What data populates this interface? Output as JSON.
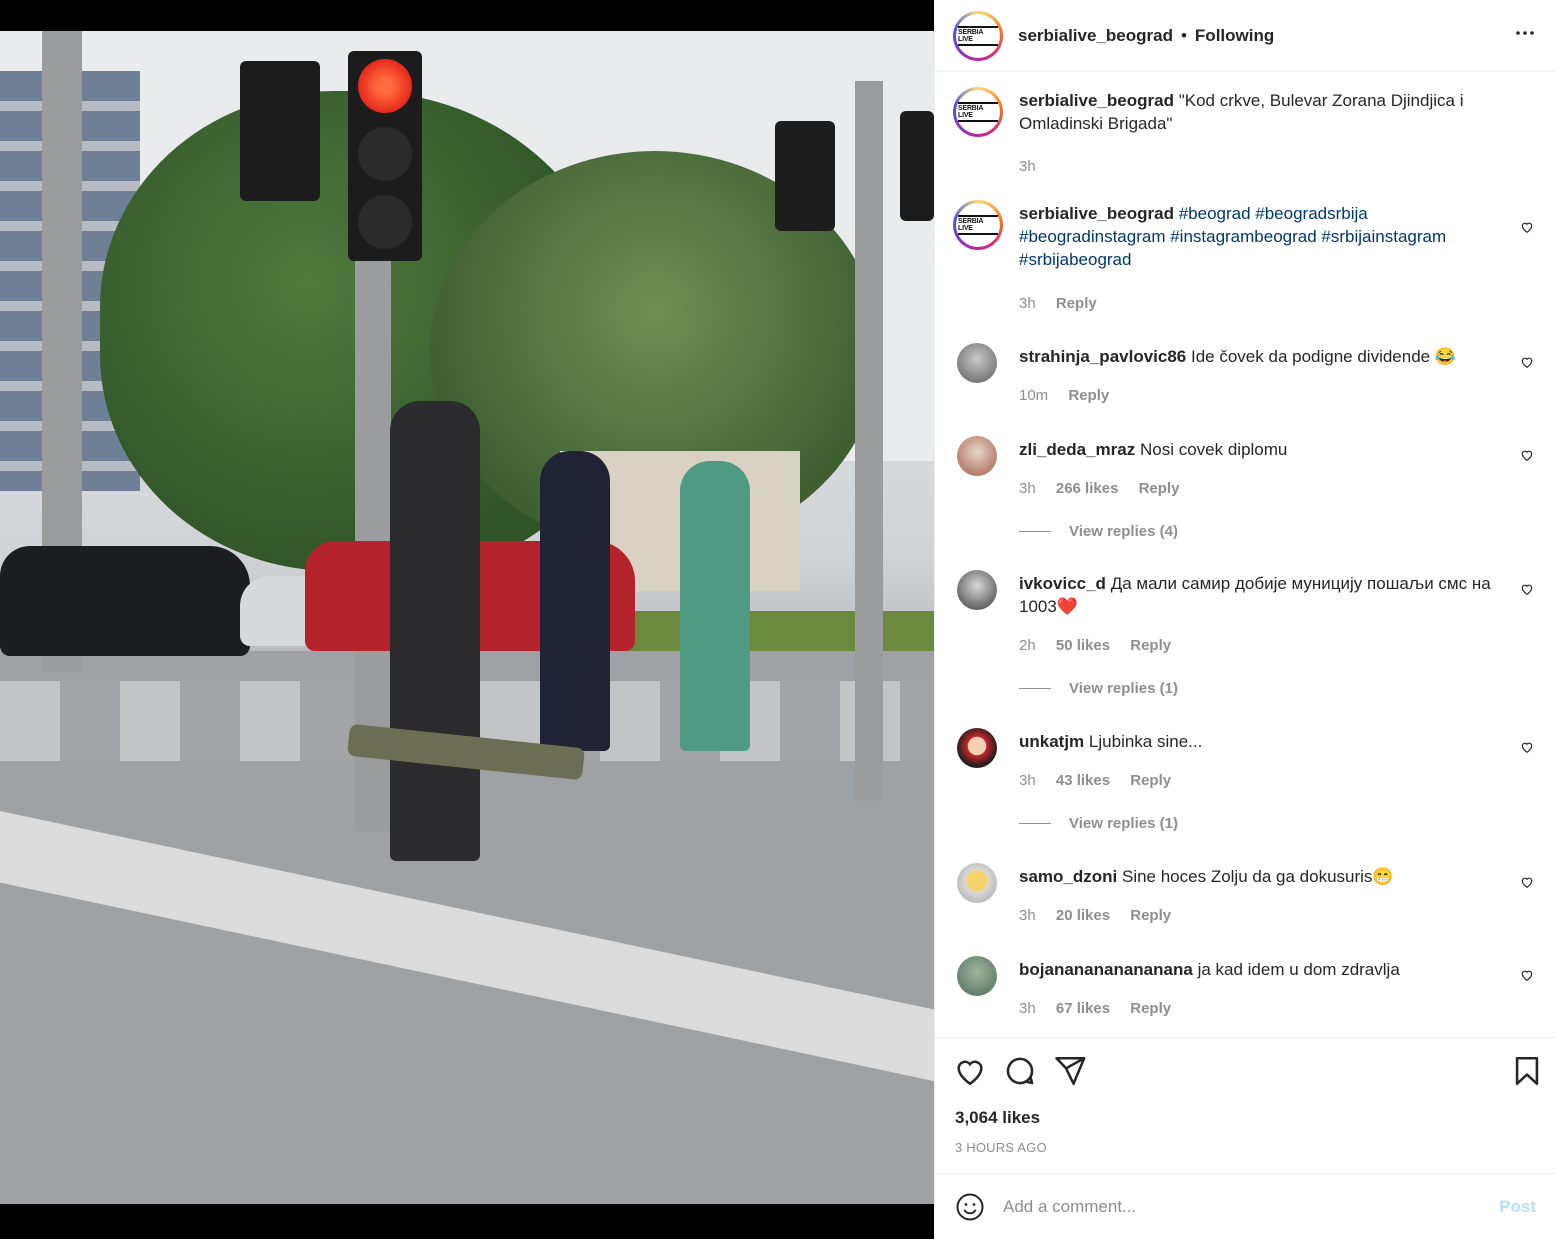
{
  "post": {
    "author": "serbialive_beograd",
    "follow_state": "Following",
    "separator": "•",
    "avatar_logo_text": "SERBIA LIVE",
    "likes": "3,064 likes",
    "time_ago": "3 HOURS AGO"
  },
  "caption": {
    "author": "serbialive_beograd",
    "text": "\"Kod crkve, Bulevar Zorana Djindjica i Omladinski Brigada\"",
    "time": "3h"
  },
  "hashtag_comment": {
    "author": "serbialive_beograd",
    "hashtags": "#beograd #beogradsrbija #beogradinstagram #instagrambeograd #srbijainstagram #srbijabeograd",
    "time": "3h",
    "reply": "Reply"
  },
  "comments": [
    {
      "author": "strahinja_pavlovic86",
      "text": "Ide čovek da podigne dividende 😂",
      "time": "10m",
      "likes": "",
      "reply": "Reply",
      "view_replies": ""
    },
    {
      "author": "zli_deda_mraz",
      "text": "Nosi covek diplomu",
      "time": "3h",
      "likes": "266 likes",
      "reply": "Reply",
      "view_replies": "View replies (4)"
    },
    {
      "author": "ivkovicc_d",
      "text": "Да мали самир добије муницију пошаљи смс на 1003❤️",
      "time": "2h",
      "likes": "50 likes",
      "reply": "Reply",
      "view_replies": "View replies (1)"
    },
    {
      "author": "unkatjm",
      "text": "Ljubinka sine...",
      "time": "3h",
      "likes": "43 likes",
      "reply": "Reply",
      "view_replies": "View replies (1)"
    },
    {
      "author": "samo_dzoni",
      "text": "Sine hoces Zolju da ga dokusuris😁",
      "time": "3h",
      "likes": "20 likes",
      "reply": "Reply",
      "view_replies": ""
    },
    {
      "author": "bojananananananana",
      "text": "ja kad idem u dom zdravlja",
      "time": "3h",
      "likes": "67 likes",
      "reply": "Reply",
      "view_replies": ""
    }
  ],
  "add_comment": {
    "placeholder": "Add a comment...",
    "post_label": "Post"
  },
  "icons": {
    "like": "heart-icon",
    "comment": "comment-icon",
    "share": "paper-plane-icon",
    "save": "bookmark-icon",
    "emoji": "smiley-icon",
    "more": "more-options-icon"
  },
  "colors": {
    "link": "#00376b",
    "muted": "#8e8e8e",
    "post_button_disabled": "#b2dffc",
    "text": "#262626"
  }
}
